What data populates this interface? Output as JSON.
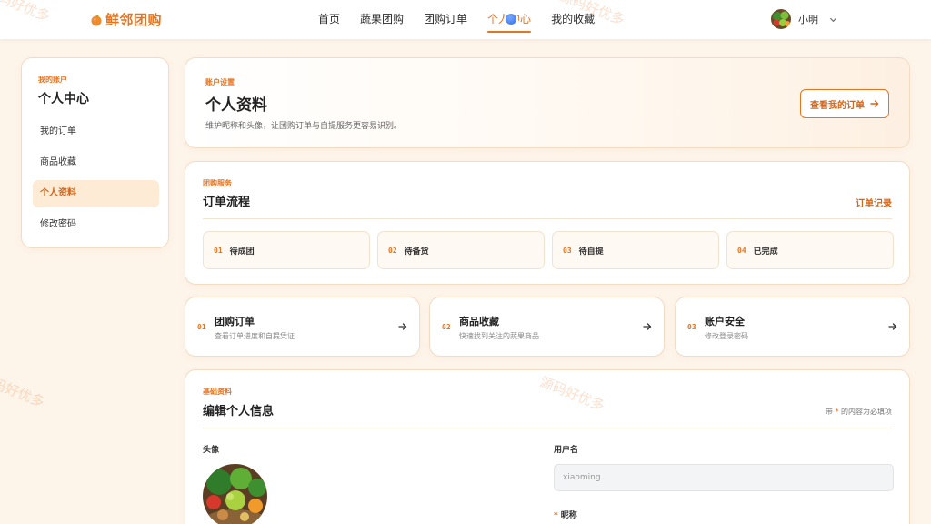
{
  "header": {
    "logo_text": "鲜邻团购",
    "nav": [
      {
        "label": "首页"
      },
      {
        "label": "蔬果团购"
      },
      {
        "label": "团购订单"
      },
      {
        "label": "个人中心",
        "active": true
      },
      {
        "label": "我的收藏"
      }
    ],
    "user_name": "小明"
  },
  "sidebar": {
    "eyebrow": "我的账户",
    "title": "个人中心",
    "items": [
      {
        "label": "我的订单"
      },
      {
        "label": "商品收藏"
      },
      {
        "label": "个人资料",
        "active": true
      },
      {
        "label": "修改密码"
      }
    ]
  },
  "profile": {
    "eyebrow": "账户设置",
    "title": "个人资料",
    "description": "维护昵称和头像，让团购订单与自提服务更容易识别。",
    "button_label": "查看我的订单"
  },
  "order_flow": {
    "eyebrow": "团购服务",
    "title": "订单流程",
    "link_label": "订单记录",
    "steps": [
      {
        "num": "01",
        "label": "待成团"
      },
      {
        "num": "02",
        "label": "待备货"
      },
      {
        "num": "03",
        "label": "待自提"
      },
      {
        "num": "04",
        "label": "已完成"
      }
    ]
  },
  "quick_links": [
    {
      "num": "01",
      "title": "团购订单",
      "desc": "查看订单进度和自提凭证"
    },
    {
      "num": "02",
      "title": "商品收藏",
      "desc": "快速找到关注的蔬果商品"
    },
    {
      "num": "03",
      "title": "账户安全",
      "desc": "修改登录密码"
    }
  ],
  "basic_info": {
    "eyebrow": "基础资料",
    "title": "编辑个人信息",
    "note_prefix": "带",
    "note_star": "*",
    "note_suffix": "的内容为必填项",
    "avatar_label": "头像",
    "username_label": "用户名",
    "username_value": "xiaoming",
    "nickname_star": "*",
    "nickname_label": "昵称"
  },
  "watermark": "源码好优多",
  "colors": {
    "accent": "#e8731f",
    "accent_dark": "#d4661a",
    "page_bg": "#fdf4ea",
    "active_bg": "#fdebd5"
  }
}
